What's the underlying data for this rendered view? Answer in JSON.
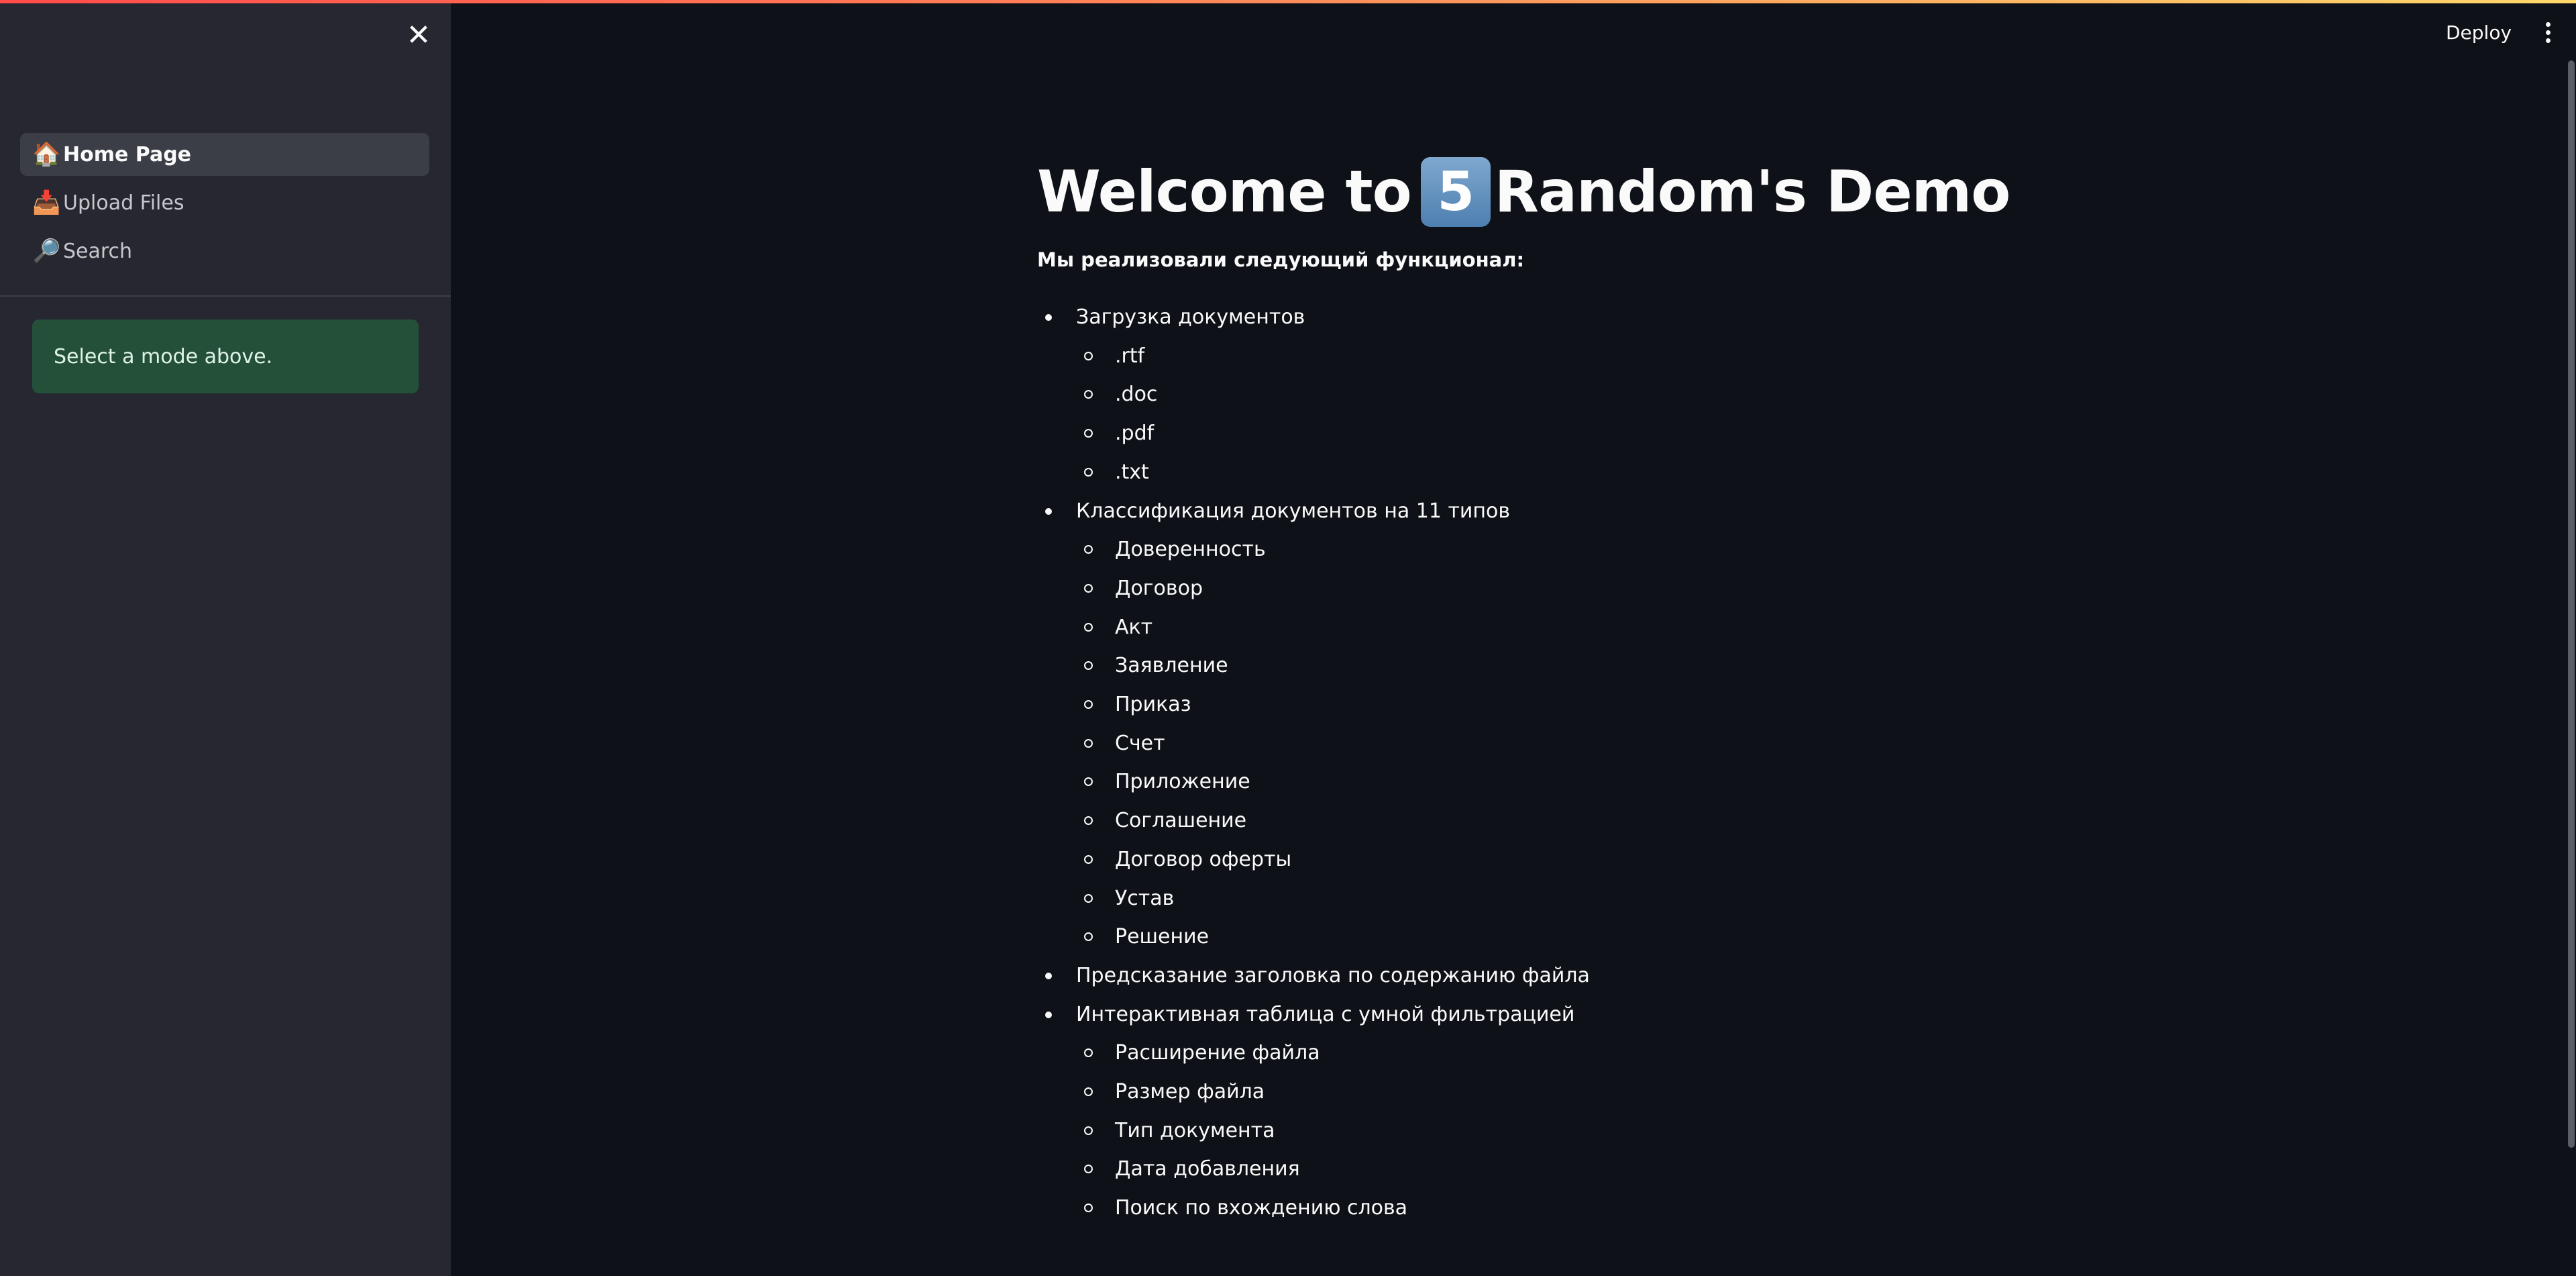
{
  "sidebar": {
    "close_icon": "close-icon",
    "nav": [
      {
        "icon": "🏠",
        "label": "Home Page",
        "active": true
      },
      {
        "icon": "📥",
        "label": "Upload Files",
        "active": false
      },
      {
        "icon": "🔎",
        "label": "Search",
        "active": false
      }
    ],
    "info_message": "Select a mode above."
  },
  "header": {
    "deploy_label": "Deploy",
    "menu_icon": "kebab-menu-icon"
  },
  "main": {
    "title_prefix": "Welcome to ",
    "title_digit": "5",
    "title_suffix": "Random's Demo",
    "intro": "Мы реализовали следующий функционал:",
    "features": [
      {
        "label": "Загрузка документов",
        "sub": [
          ".rtf",
          ".doc",
          ".pdf",
          ".txt"
        ]
      },
      {
        "label": "Классификация документов на 11 типов",
        "sub": [
          "Доверенность",
          "Договор",
          "Акт",
          "Заявление",
          "Приказ",
          "Счет",
          "Приложение",
          "Соглашение",
          "Договор оферты",
          "Устав",
          "Решение"
        ]
      },
      {
        "label": "Предсказание заголовка по содержанию файла",
        "sub": []
      },
      {
        "label": "Интерактивная таблица с умной фильтрацией",
        "sub": [
          "Расширение файла",
          "Размер файла",
          "Тип документа",
          "Дата добавления",
          "Поиск по вхождению слова"
        ]
      }
    ]
  },
  "colors": {
    "background": "#0e1117",
    "sidebar": "#262730",
    "info_bg": "#24503a",
    "accent": "#ff4b4b"
  }
}
